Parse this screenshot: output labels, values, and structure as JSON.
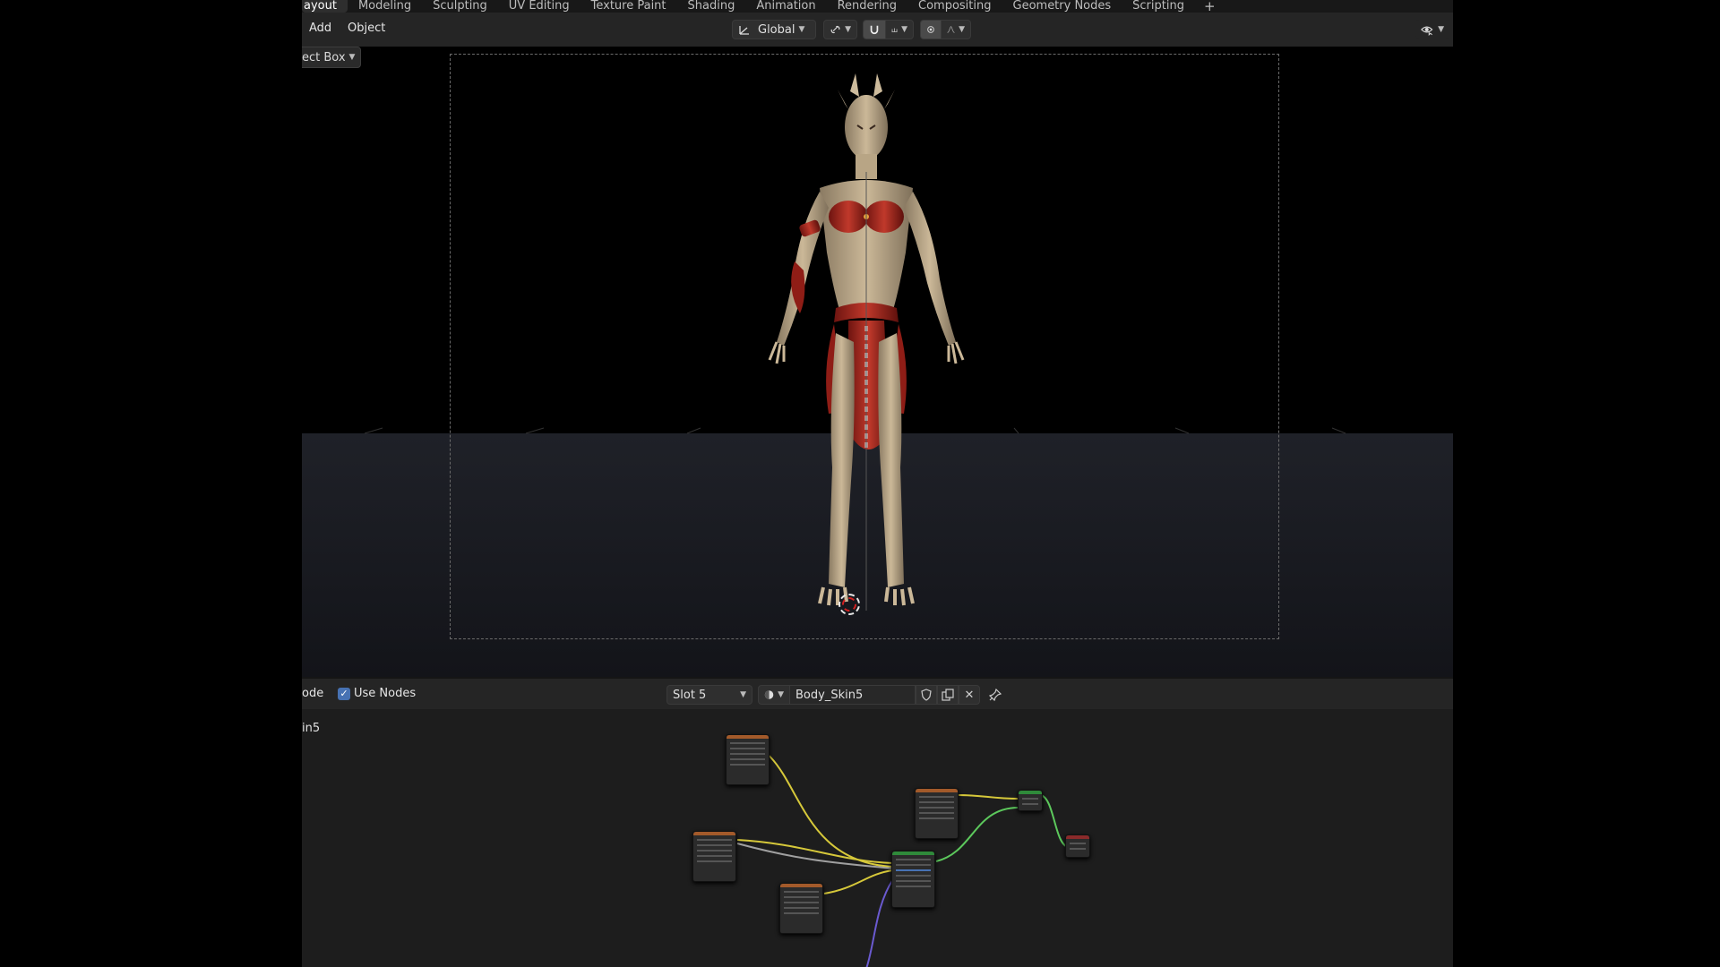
{
  "workspace_tabs": {
    "active": "ayout",
    "items": [
      "Modeling",
      "Sculpting",
      "UV Editing",
      "Texture Paint",
      "Shading",
      "Animation",
      "Rendering",
      "Compositing",
      "Geometry Nodes",
      "Scripting"
    ],
    "add": "+"
  },
  "viewport_header": {
    "menu_add": "Add",
    "menu_object": "Object",
    "transform_orientation": "Global"
  },
  "viewport": {
    "select_mode": "ect Box"
  },
  "node_editor": {
    "mode_label": "ode",
    "use_nodes_label": "Use Nodes",
    "use_nodes_checked": true,
    "slot": "Slot 5",
    "material_name": "Body_Skin5",
    "breadcrumb": "in5"
  },
  "colors": {
    "accent": "#4772b3",
    "link_yellow": "#d6c83a",
    "link_green": "#5cc85c",
    "link_purple": "#6a5ad0",
    "link_gray": "#a0a0a0"
  }
}
